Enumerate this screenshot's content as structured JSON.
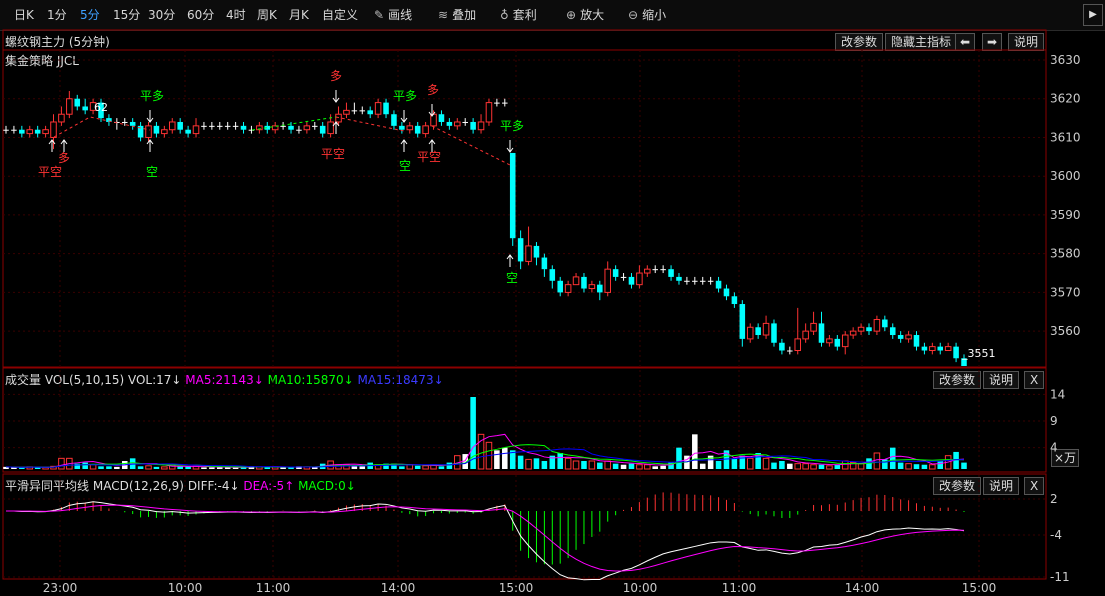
{
  "toolbar": {
    "periods": [
      "日K",
      "1分",
      "5分",
      "15分",
      "30分",
      "60分",
      "4时",
      "周K",
      "月K",
      "自定义"
    ],
    "active_index": 2,
    "tools": [
      {
        "icon": "pencil-icon",
        "label": "画线"
      },
      {
        "icon": "stack-icon",
        "label": "叠加"
      },
      {
        "icon": "money-bag-icon",
        "label": "套利"
      },
      {
        "icon": "zoom-in-icon",
        "label": "放大"
      },
      {
        "icon": "zoom-out-icon",
        "label": "缩小"
      }
    ]
  },
  "main_panel": {
    "title": "螺纹钢主力 (5分钟)",
    "strategy": "集金策略 JJCL",
    "buttons": [
      "改参数",
      "隐藏主指标",
      "说明"
    ],
    "price_axis": [
      "3630",
      "3620",
      "3610",
      "3600",
      "3590",
      "3580",
      "3570",
      "3560"
    ],
    "high_label": "3620",
    "high_label_shown": "62",
    "low_label": "3551"
  },
  "vol_panel": {
    "title": "成交量",
    "params": "VOL(5,10,15)",
    "vol": "VOL:17↓",
    "ma5": "MA5:21143↓",
    "ma10": "MA10:15870↓",
    "ma15": "MA15:18473↓",
    "buttons": [
      "改参数",
      "说明",
      "X"
    ],
    "axis": [
      "14",
      "9",
      "4"
    ],
    "unit": "×万"
  },
  "macd_panel": {
    "title": "平滑异同平均线",
    "params": "MACD(12,26,9)",
    "diff": "DIFF:-4↓",
    "dea": "DEA:-5↑",
    "macd": "MACD:0↓",
    "buttons": [
      "改参数",
      "说明",
      "X"
    ],
    "axis": [
      "2",
      "-4",
      "-11"
    ]
  },
  "time_axis": [
    "23:00",
    "10:00",
    "11:00",
    "14:00",
    "15:00",
    "10:00",
    "11:00",
    "14:00",
    "15:00"
  ],
  "colors": {
    "up": "#ff3333",
    "down": "#00ffff",
    "ma5": "#ff00ff",
    "ma10": "#00ff00",
    "ma15": "#0000ff",
    "grid": "#3a0000"
  },
  "chart_data": {
    "type": "candlestick",
    "ylim": [
      3551,
      3630
    ],
    "candles": [
      [
        3612,
        3612,
        3613,
        3611
      ],
      [
        3612,
        3612,
        3613,
        3611
      ],
      [
        3612,
        3611,
        3613,
        3610
      ],
      [
        3611,
        3612,
        3613,
        3610
      ],
      [
        3612,
        3611,
        3613,
        3610
      ],
      [
        3611,
        3612,
        3613,
        3610
      ],
      [
        3610,
        3614,
        3616,
        3607
      ],
      [
        3614,
        3616,
        3618,
        3613
      ],
      [
        3616,
        3620,
        3622,
        3615
      ],
      [
        3620,
        3618,
        3621,
        3617
      ],
      [
        3618,
        3617,
        3620,
        3616
      ],
      [
        3617,
        3619,
        3620,
        3616
      ],
      [
        3619,
        3615,
        3620,
        3614
      ],
      [
        3615,
        3614,
        3616,
        3613
      ],
      [
        3614,
        3614,
        3615,
        3612
      ],
      [
        3614,
        3614,
        3615,
        3613
      ],
      [
        3614,
        3613,
        3615,
        3612
      ],
      [
        3613,
        3610,
        3614,
        3609
      ],
      [
        3610,
        3613,
        3614,
        3609
      ],
      [
        3613,
        3611,
        3614,
        3610
      ],
      [
        3611,
        3612,
        3613,
        3610
      ],
      [
        3612,
        3614,
        3615,
        3611
      ],
      [
        3614,
        3612,
        3615,
        3611
      ],
      [
        3612,
        3611,
        3613,
        3610
      ],
      [
        3611,
        3613,
        3615,
        3610
      ],
      [
        3613,
        3613,
        3614,
        3612
      ],
      [
        3613,
        3613,
        3614,
        3612
      ],
      [
        3613,
        3613,
        3614,
        3612
      ],
      [
        3613,
        3613,
        3614,
        3612
      ],
      [
        3613,
        3613,
        3614,
        3612
      ],
      [
        3613,
        3612,
        3614,
        3611
      ],
      [
        3612,
        3612,
        3613,
        3611
      ],
      [
        3612,
        3613,
        3614,
        3611
      ],
      [
        3613,
        3612,
        3614,
        3611
      ],
      [
        3612,
        3613,
        3614,
        3611
      ],
      [
        3613,
        3613,
        3614,
        3612
      ],
      [
        3613,
        3612,
        3614,
        3611
      ],
      [
        3612,
        3612,
        3613,
        3611
      ],
      [
        3612,
        3613,
        3614,
        3611
      ],
      [
        3613,
        3613,
        3614,
        3612
      ],
      [
        3613,
        3611,
        3614,
        3610
      ],
      [
        3611,
        3614,
        3616,
        3610
      ],
      [
        3614,
        3616,
        3618,
        3613
      ],
      [
        3616,
        3617,
        3619,
        3615
      ],
      [
        3617,
        3617,
        3619,
        3616
      ],
      [
        3617,
        3617,
        3618,
        3616
      ],
      [
        3617,
        3616,
        3618,
        3615
      ],
      [
        3616,
        3619,
        3620,
        3615
      ],
      [
        3619,
        3616,
        3620,
        3615
      ],
      [
        3616,
        3613,
        3617,
        3612
      ],
      [
        3613,
        3612,
        3614,
        3611
      ],
      [
        3612,
        3613,
        3614,
        3611
      ],
      [
        3613,
        3611,
        3614,
        3610
      ],
      [
        3611,
        3613,
        3614,
        3610
      ],
      [
        3613,
        3616,
        3617,
        3612
      ],
      [
        3616,
        3614,
        3617,
        3613
      ],
      [
        3614,
        3613,
        3615,
        3612
      ],
      [
        3613,
        3614,
        3615,
        3612
      ],
      [
        3614,
        3614,
        3615,
        3613
      ],
      [
        3614,
        3612,
        3615,
        3611
      ],
      [
        3612,
        3614,
        3616,
        3611
      ],
      [
        3614,
        3619,
        3620,
        3613
      ],
      [
        3619,
        3619,
        3620,
        3618
      ],
      [
        3619,
        3619,
        3620,
        3618
      ],
      [
        3606,
        3584,
        3606,
        3582
      ],
      [
        3584,
        3578,
        3586,
        3576
      ],
      [
        3578,
        3582,
        3587,
        3577
      ],
      [
        3582,
        3579,
        3583,
        3577
      ],
      [
        3579,
        3576,
        3580,
        3574
      ],
      [
        3576,
        3573,
        3577,
        3571
      ],
      [
        3573,
        3570,
        3574,
        3569
      ],
      [
        3570,
        3572,
        3573,
        3569
      ],
      [
        3572,
        3574,
        3575,
        3572
      ],
      [
        3574,
        3571,
        3575,
        3570
      ],
      [
        3571,
        3572,
        3573,
        3570
      ],
      [
        3572,
        3570,
        3573,
        3568
      ],
      [
        3570,
        3576,
        3578,
        3569
      ],
      [
        3576,
        3574,
        3577,
        3573
      ],
      [
        3574,
        3574,
        3575,
        3573
      ],
      [
        3574,
        3572,
        3575,
        3571
      ],
      [
        3572,
        3575,
        3577,
        3571
      ],
      [
        3575,
        3576,
        3577,
        3574
      ],
      [
        3576,
        3576,
        3577,
        3575
      ],
      [
        3576,
        3576,
        3577,
        3575
      ],
      [
        3576,
        3574,
        3577,
        3573
      ],
      [
        3574,
        3573,
        3575,
        3572
      ],
      [
        3573,
        3573,
        3574,
        3572
      ],
      [
        3573,
        3573,
        3574,
        3572
      ],
      [
        3573,
        3573,
        3574,
        3572
      ],
      [
        3573,
        3573,
        3574,
        3572
      ],
      [
        3573,
        3571,
        3574,
        3570
      ],
      [
        3571,
        3569,
        3572,
        3568
      ],
      [
        3569,
        3567,
        3570,
        3566
      ],
      [
        3567,
        3558,
        3568,
        3556
      ],
      [
        3558,
        3561,
        3562,
        3557
      ],
      [
        3561,
        3559,
        3562,
        3558
      ],
      [
        3559,
        3562,
        3564,
        3558
      ],
      [
        3562,
        3557,
        3563,
        3556
      ],
      [
        3557,
        3555,
        3558,
        3554
      ],
      [
        3555,
        3555,
        3556,
        3554
      ],
      [
        3555,
        3558,
        3566,
        3554
      ],
      [
        3558,
        3560,
        3562,
        3557
      ],
      [
        3560,
        3562,
        3565,
        3559
      ],
      [
        3562,
        3557,
        3565,
        3556
      ],
      [
        3557,
        3558,
        3559,
        3556
      ],
      [
        3558,
        3556,
        3559,
        3555
      ],
      [
        3556,
        3559,
        3560,
        3554
      ],
      [
        3559,
        3560,
        3561,
        3558
      ],
      [
        3560,
        3561,
        3562,
        3559
      ],
      [
        3561,
        3560,
        3562,
        3559
      ],
      [
        3560,
        3563,
        3564,
        3559
      ],
      [
        3563,
        3561,
        3564,
        3560
      ],
      [
        3561,
        3559,
        3562,
        3558
      ],
      [
        3559,
        3558,
        3560,
        3557
      ],
      [
        3558,
        3559,
        3560,
        3557
      ],
      [
        3559,
        3556,
        3560,
        3555
      ],
      [
        3556,
        3555,
        3557,
        3554
      ],
      [
        3555,
        3556,
        3557,
        3554
      ],
      [
        3556,
        3555,
        3557,
        3554
      ],
      [
        3555,
        3556,
        3557,
        3555
      ],
      [
        3556,
        3553,
        3557,
        3552
      ],
      [
        3553,
        3551,
        3554,
        3551
      ]
    ],
    "volumes": [
      0.4,
      0.3,
      0.3,
      0.4,
      0.3,
      0.3,
      0.5,
      2.0,
      2.0,
      1.0,
      1.2,
      0.8,
      0.5,
      0.5,
      0.4,
      1.5,
      2.0,
      0.5,
      0.6,
      0.4,
      0.4,
      0.7,
      0.5,
      0.5,
      0.5,
      0.3,
      0.3,
      0.3,
      0.3,
      0.3,
      0.4,
      0.5,
      0.4,
      0.4,
      0.4,
      0.3,
      0.3,
      0.5,
      0.4,
      0.4,
      1.0,
      1.5,
      0.8,
      0.8,
      0.5,
      0.5,
      1.2,
      0.8,
      1.0,
      1.0,
      0.5,
      0.8,
      0.6,
      0.6,
      0.8,
      0.5,
      1.2,
      2.5,
      2.8,
      13.5,
      6.5,
      5.0,
      3.5,
      4.0,
      3.5,
      2.5,
      1.8,
      2.0,
      1.5,
      2.5,
      3.0,
      2.0,
      1.5,
      1.5,
      1.5,
      1.2,
      1.5,
      1.0,
      0.8,
      1.0,
      0.8,
      0.8,
      0.5,
      0.6,
      1.2,
      4.0,
      2.5,
      6.5,
      1.0,
      2.5,
      1.5,
      3.5,
      2.0,
      2.5,
      2.0,
      3.0,
      2.0,
      1.2,
      1.5,
      1.0,
      1.0,
      1.0,
      0.8,
      0.8,
      0.6,
      0.8,
      1.5,
      1.2,
      1.0,
      2.0,
      3.0,
      1.8,
      4.0,
      1.2,
      1.0,
      0.9,
      0.8,
      0.8,
      1.5,
      2.5,
      3.2,
      1.2,
      0.8,
      1.2,
      1.5,
      4.0
    ],
    "volume_ylim": [
      0,
      15
    ],
    "macd_ylim": [
      -11,
      3
    ]
  },
  "signals": [
    {
      "label": "平空",
      "type": "buy"
    },
    {
      "label": "多",
      "type": "buy"
    },
    {
      "label": "平多",
      "type": "sell"
    },
    {
      "label": "空",
      "type": "sell"
    },
    {
      "label": "多",
      "type": "buy"
    },
    {
      "label": "平空",
      "type": "buy"
    },
    {
      "label": "平多",
      "type": "sell"
    },
    {
      "label": "空",
      "type": "sell"
    },
    {
      "label": "多",
      "type": "buy"
    },
    {
      "label": "平空",
      "type": "buy"
    },
    {
      "label": "平多",
      "type": "sell"
    },
    {
      "label": "空",
      "type": "sell"
    }
  ]
}
